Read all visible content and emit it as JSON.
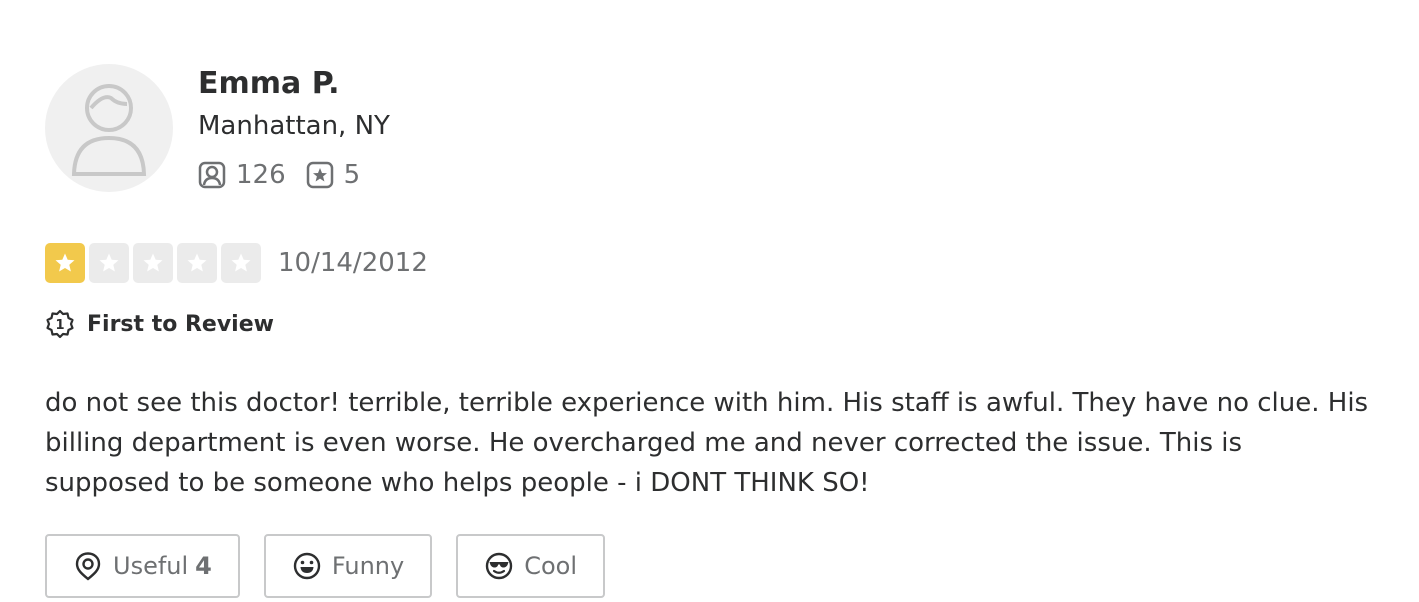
{
  "user": {
    "name": "Emma P.",
    "location": "Manhattan, NY",
    "friends_count": "126",
    "reviews_count": "5",
    "avatar_icon": "default-avatar-icon"
  },
  "review": {
    "rating": 1,
    "max_rating": 5,
    "date": "10/14/2012",
    "badge": "First to Review",
    "text": "do not see this doctor! terrible, terrible experience with him. His staff is awful. They have no clue. His billing department is even worse. He overcharged me and never corrected the issue. This is supposed to be someone who helps people - i DONT THINK SO!"
  },
  "actions": {
    "useful_label": "Useful",
    "useful_count": "4",
    "funny_label": "Funny",
    "cool_label": "Cool"
  },
  "colors": {
    "star_filled": "#f2c94c",
    "star_empty": "#ebebeb",
    "text_primary": "#2d2e2f",
    "text_secondary": "#6e7072",
    "button_border": "#c8c9ca"
  }
}
